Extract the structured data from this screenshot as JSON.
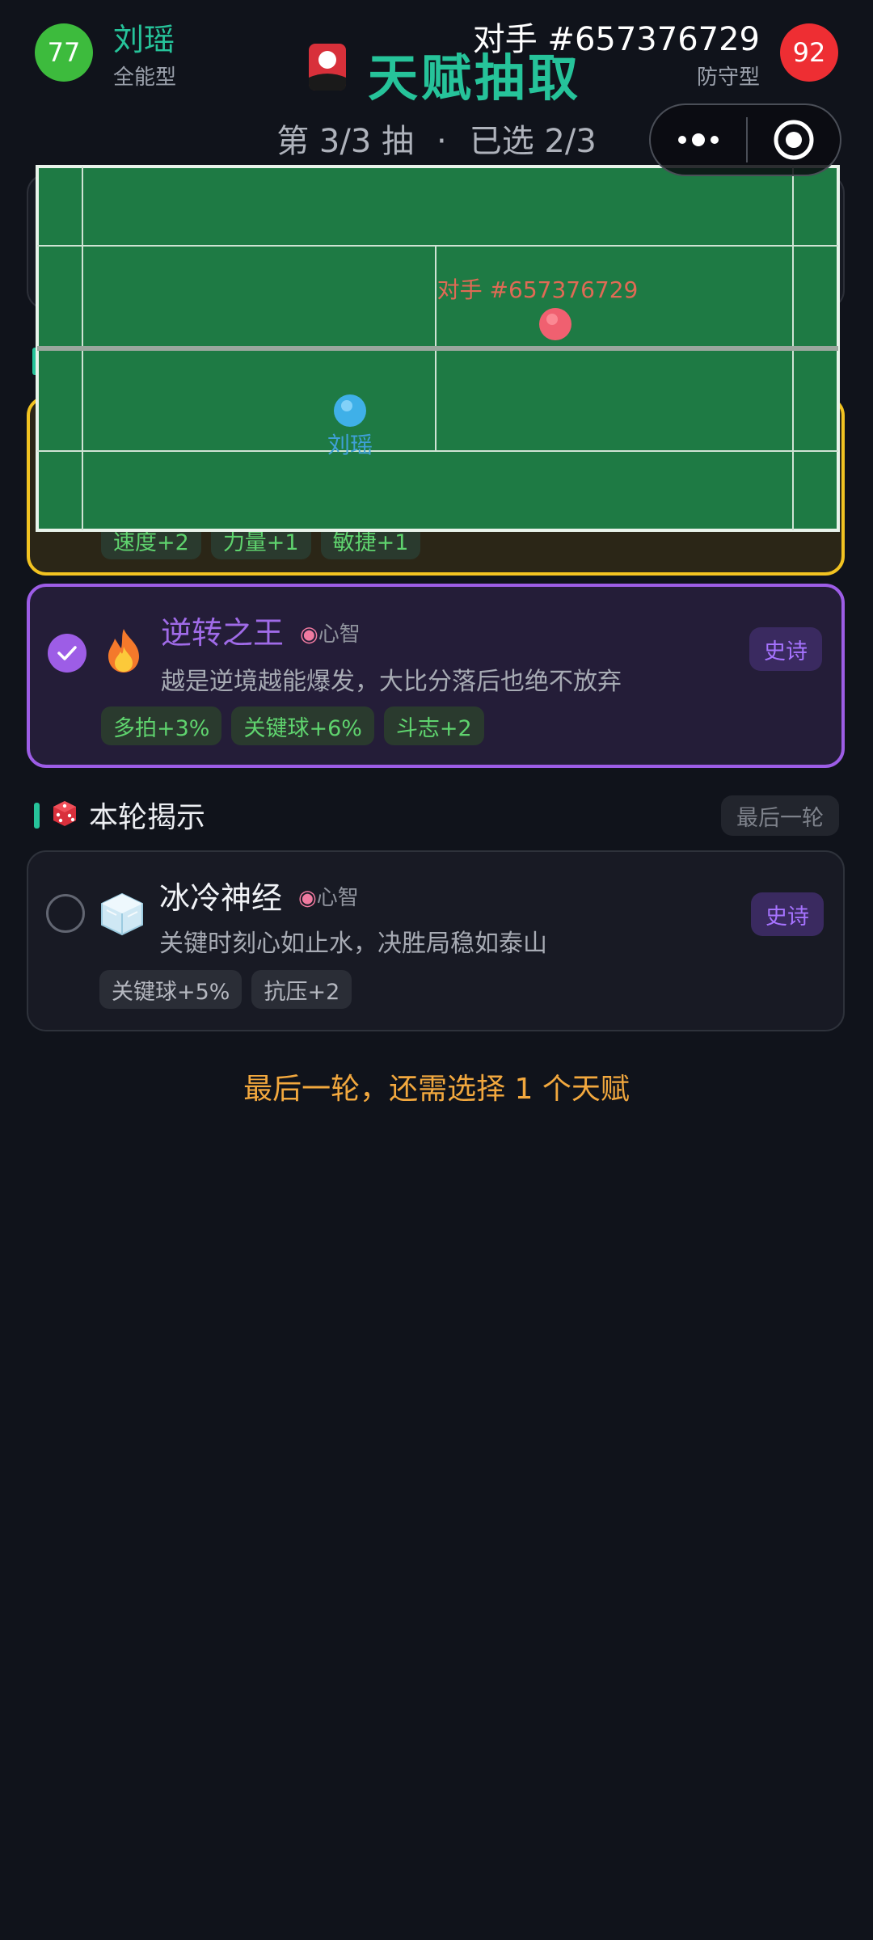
{
  "player": {
    "name": "刘瑶",
    "type": "全能型",
    "rating": "77"
  },
  "opponent": {
    "name": "对手 #657376729",
    "type": "防守型",
    "rating": "92"
  },
  "header": {
    "title": "天赋抽取",
    "icon": "red-card-icon"
  },
  "round": {
    "draw": "第 3/3 抽",
    "separator": "·",
    "selected": "已选 2/3"
  },
  "capsule": {
    "more_icon": "more-dots-icon",
    "close_icon": "target-close-icon"
  },
  "court": {
    "player_label": "刘瑶",
    "opponent_label": "对手 #657376729",
    "colors": {
      "grass": "#1e7a44",
      "player": "#3fb0e8",
      "opponent": "#f06070"
    }
  },
  "hidden_card": {
    "stats": [
      "速度+2",
      "力量+1",
      "敏捷+1"
    ]
  },
  "selected_card": {
    "title": "逆转之王",
    "category": "心智",
    "category_icon": "brain-icon",
    "icon": "fire-icon",
    "description": "越是逆境越能爆发，大比分落后也绝不放弃",
    "rarity": "史诗",
    "stats": [
      "多拍+3%",
      "关键球+6%",
      "斗志+2"
    ],
    "checked": true
  },
  "reveal_section": {
    "icon": "dice-icon",
    "title": "本轮揭示",
    "badge": "最后一轮"
  },
  "reveal_card": {
    "title": "冰冷神经",
    "category": "心智",
    "category_icon": "brain-icon",
    "icon": "ice-cube-icon",
    "description": "关键时刻心如止水，决胜局稳如泰山",
    "rarity": "史诗",
    "stats": [
      "关键球+5%",
      "抗压+2"
    ],
    "checked": false
  },
  "footer": {
    "hint": "最后一轮，还需选择 1 个天赋"
  },
  "colors": {
    "accent": "#26c39a",
    "epic": "#9d5de6",
    "gold": "#f2c321",
    "hint": "#f2a83e",
    "background": "#10131b"
  }
}
